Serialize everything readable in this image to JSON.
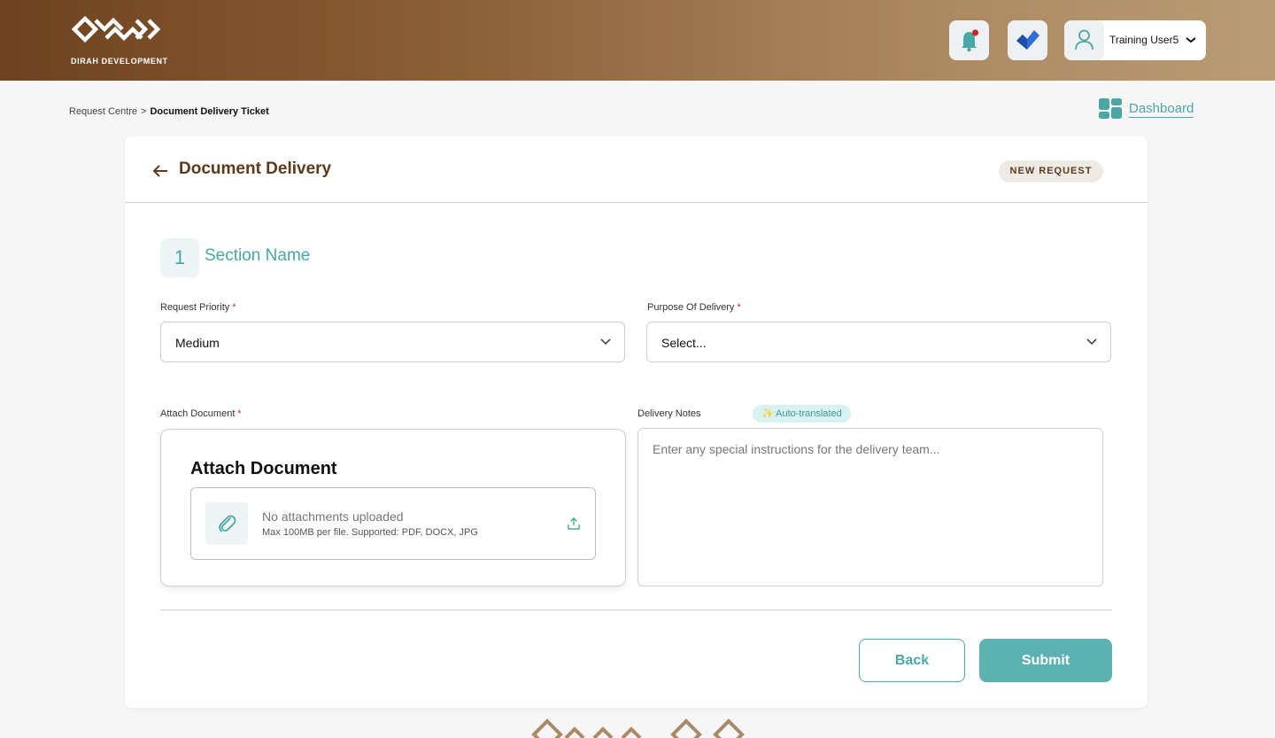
{
  "header": {
    "logo_text": "DIRAH DEVELOPMENT",
    "user_name": "Training User5",
    "icons": [
      "bell-icon",
      "tasks-check-icon",
      "user-icon",
      "chevron-down-icon"
    ],
    "colors": {
      "brand_dark": "#6e4220",
      "brand_light": "#b99c75",
      "accent": "#4aa7a7",
      "notification_dot": "#c62828"
    }
  },
  "breadcrumb": {
    "items": [
      "Request Centre",
      "Document Delivery Ticket"
    ],
    "separator": ">"
  },
  "dashboard_link": {
    "label": "Dashboard",
    "icon": "dashboard-grid-icon"
  },
  "form": {
    "title": "Document Delivery",
    "status_badge": "NEW REQUEST",
    "section": {
      "number": "1",
      "title": "Section Name"
    },
    "request_priority": {
      "label": "Request Priority",
      "required_mark": "*",
      "value": "Medium"
    },
    "purpose_of_delivery": {
      "label": "Purpose Of Delivery",
      "required_mark": "*",
      "value": "Select..."
    },
    "attach_document": {
      "label": "Attach Document",
      "required_mark": "*",
      "box_title": "Attach Document",
      "empty_text": "No attachments uploaded",
      "hint": "Max 100MB per file. Supported: PDF, DOCX, JPG"
    },
    "delivery_notes": {
      "label": "Delivery Notes",
      "badge": "✨ Auto-translated",
      "placeholder": "Enter any special instructions for the delivery team..."
    },
    "buttons": {
      "back": "Back",
      "submit": "Submit"
    }
  }
}
